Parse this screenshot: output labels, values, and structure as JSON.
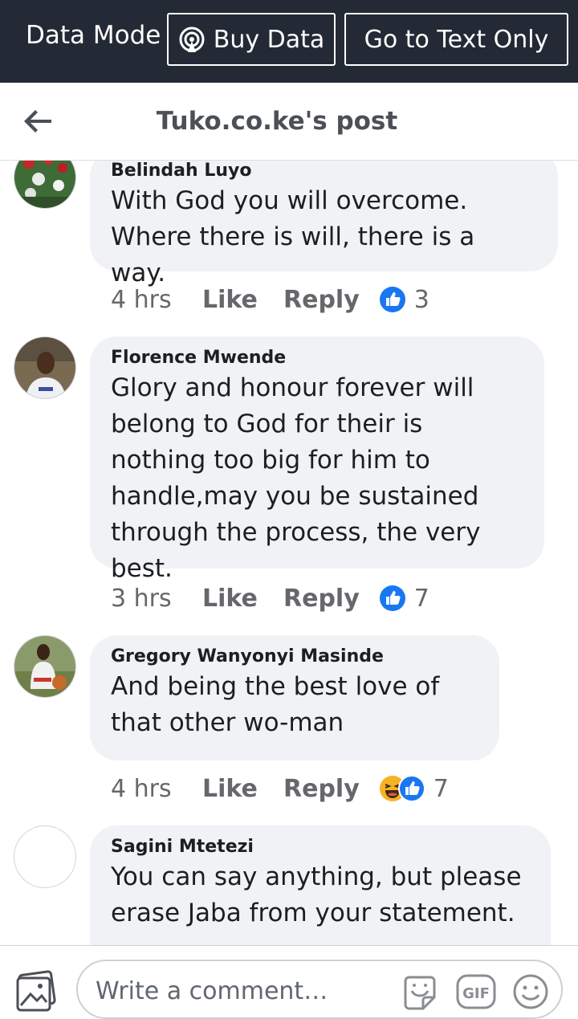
{
  "topbar": {
    "data_mode_label": "Data Mode",
    "buy_data_label": "Buy Data",
    "text_only_label": "Go to Text Only"
  },
  "header": {
    "title": "Tuko.co.ke's post",
    "back_icon": "back-arrow-icon"
  },
  "comments": [
    {
      "author": "Belindah Luyo",
      "text": "With God you will overcome. Where there is will, there is a way.",
      "time": "4 hrs",
      "like_label": "Like",
      "reply_label": "Reply",
      "reactions": [
        "like"
      ],
      "reaction_count": "3"
    },
    {
      "author": "Florence Mwende",
      "text": "Glory and honour forever will belong to God for their is nothing too big for him to handle,may you be sustained through the process, the very best.",
      "time": "3 hrs",
      "like_label": "Like",
      "reply_label": "Reply",
      "reactions": [
        "like"
      ],
      "reaction_count": "7"
    },
    {
      "author": "Gregory Wanyonyi Masinde",
      "text": "And being the best love of that other wo-man",
      "time": "4 hrs",
      "like_label": "Like",
      "reply_label": "Reply",
      "reactions": [
        "haha",
        "like"
      ],
      "reaction_count": "7"
    },
    {
      "author": "Sagini Mtetezi",
      "text": "You can say anything, but please erase Jaba from your statement."
    }
  ],
  "composer": {
    "placeholder": "Write a comment…",
    "icons": [
      "photo-icon",
      "sticker-icon",
      "gif-icon",
      "emoji-icon"
    ],
    "gif_label": "GIF"
  },
  "colors": {
    "topbar_bg": "#242a35",
    "bubble_bg": "#f0f2f5",
    "like_blue": "#1877f2",
    "haha_yellow": "#f7b125"
  }
}
